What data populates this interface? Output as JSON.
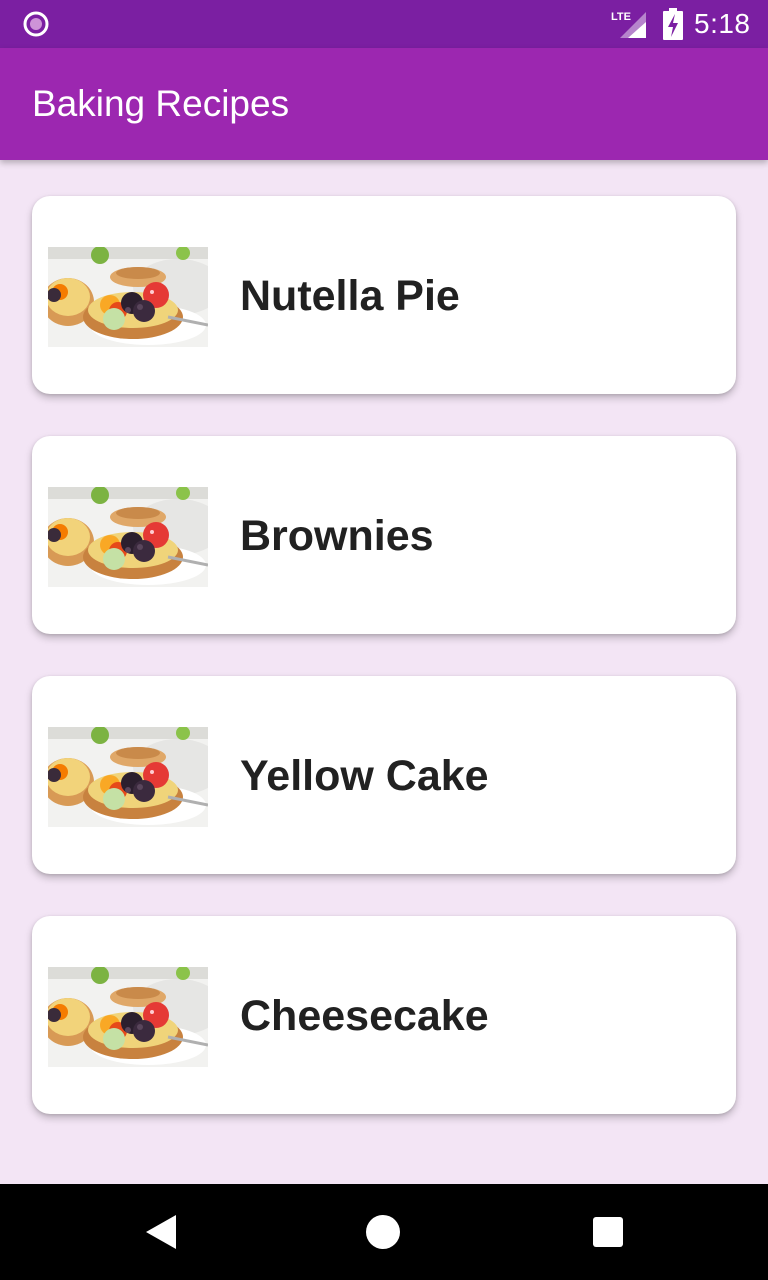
{
  "status_bar": {
    "time": "5:18",
    "network_label": "LTE",
    "left_icon": "notification-circle-icon",
    "battery_icon": "battery-charging-icon"
  },
  "app_bar": {
    "title": "Baking Recipes",
    "color": "#9c27b0",
    "status_color": "#7b1fa2"
  },
  "recipes": [
    {
      "name": "Nutella Pie",
      "thumbnail": "fruit-tart-image"
    },
    {
      "name": "Brownies",
      "thumbnail": "fruit-tart-image"
    },
    {
      "name": "Yellow Cake",
      "thumbnail": "fruit-tart-image"
    },
    {
      "name": "Cheesecake",
      "thumbnail": "fruit-tart-image"
    }
  ],
  "nav_bar": {
    "back_icon": "back-triangle-icon",
    "home_icon": "home-circle-icon",
    "recents_icon": "recents-square-icon"
  },
  "colors": {
    "background": "#f3e5f5",
    "card": "#ffffff",
    "text": "#212121"
  }
}
